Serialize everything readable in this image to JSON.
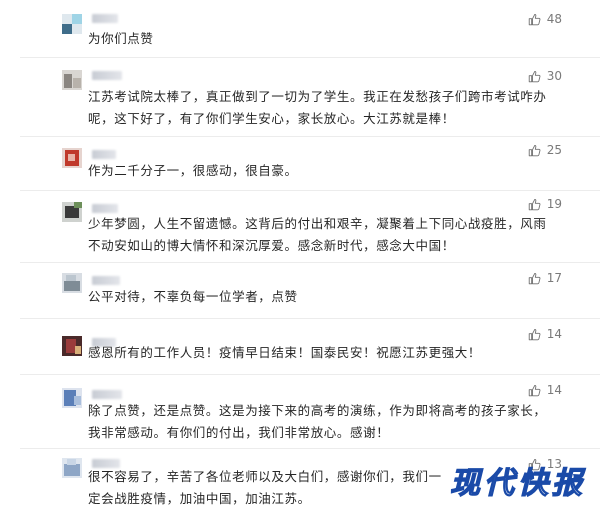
{
  "comments": [
    {
      "text": "为你们点赞",
      "likes": "48"
    },
    {
      "text": "江苏考试院太棒了，真正做到了一切为了学生。我正在发愁孩子们跨市考试咋办呢，这下好了，有了你们学生安心，家长放心。大江苏就是棒！",
      "likes": "30"
    },
    {
      "text": "作为二千分子一，很感动，很自豪。",
      "likes": "25"
    },
    {
      "text": "少年梦圆，人生不留遗憾。这背后的付出和艰辛，凝聚着上下同心战疫胜，风雨不动安如山的博大情怀和深沉厚爱。感念新时代，感念大中国！",
      "likes": "19"
    },
    {
      "text": "公平对待，不辜负每一位学者，点赞",
      "likes": "17"
    },
    {
      "text": "感恩所有的工作人员！疫情早日结束！国泰民安！祝愿江苏更强大！",
      "likes": "14"
    },
    {
      "text": "除了点赞，还是点赞。这是为接下来的高考的演练，作为即将高考的孩子家长，我非常感动。有你们的付出，我们非常放心。感谢！",
      "likes": "14"
    },
    {
      "text": "很不容易了，辛苦了各位老师以及大白们，感谢你们，我们一定会战胜疫情，加油中国，加油江苏。",
      "likes": "13"
    }
  ],
  "icons": {
    "like": "thumbs-up-icon"
  },
  "colors": {
    "like": "#6f6f6f",
    "watermark_stroke": "#1a4aa8"
  },
  "watermark": "现代快报"
}
